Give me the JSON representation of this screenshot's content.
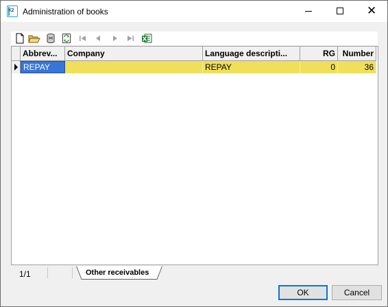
{
  "window": {
    "title": "Administration of books",
    "app_icon": "k2-app-icon",
    "app_icon_text": "K2"
  },
  "toolbar": {
    "icons": [
      "new-document-icon",
      "open-folder-icon",
      "database-icon",
      "refresh-icon",
      "first-record-icon",
      "previous-record-icon",
      "next-record-icon",
      "last-record-icon",
      "excel-export-icon"
    ]
  },
  "grid": {
    "columns": [
      {
        "label": "Abbrev..."
      },
      {
        "label": "Company"
      },
      {
        "label": "Language descripti..."
      },
      {
        "label": "RG"
      },
      {
        "label": "Number"
      }
    ],
    "rows": [
      {
        "abbrev": "REPAY",
        "company": "",
        "language_description": "REPAY",
        "rg": "0",
        "number": "36"
      }
    ],
    "selected_row_color": "#f0df5a",
    "focus_cell_color": "#3875d7"
  },
  "status": {
    "page": "1/1",
    "tab_label": "Other receivables"
  },
  "buttons": {
    "ok": "OK",
    "cancel": "Cancel"
  }
}
